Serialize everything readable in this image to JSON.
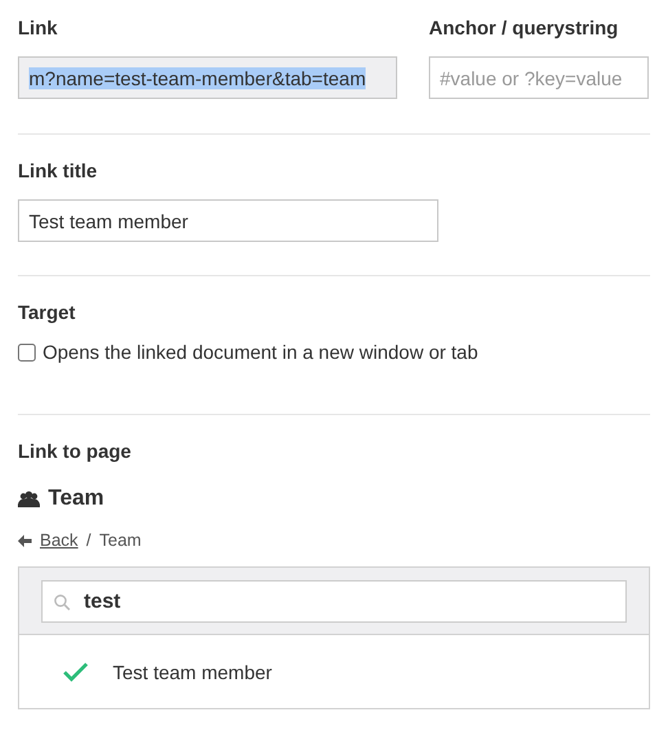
{
  "link": {
    "label": "Link",
    "value": "m?name=test-team-member&tab=team",
    "text_selected": true
  },
  "anchor": {
    "label": "Anchor / querystring",
    "placeholder": "#value or ?key=value"
  },
  "link_title": {
    "label": "Link title",
    "value": "Test team member"
  },
  "target": {
    "label": "Target",
    "option": "Opens the linked document in a new window or tab",
    "checked": false
  },
  "link_to_page": {
    "label": "Link to page",
    "heading": "Team",
    "breadcrumb_separator": "/",
    "breadcrumb": [
      {
        "kind": "back",
        "label": "Back"
      },
      {
        "kind": "current",
        "label": "Team"
      }
    ],
    "search": {
      "value": "test"
    },
    "results": [
      {
        "label": "Test team member",
        "selected": true
      }
    ]
  }
}
